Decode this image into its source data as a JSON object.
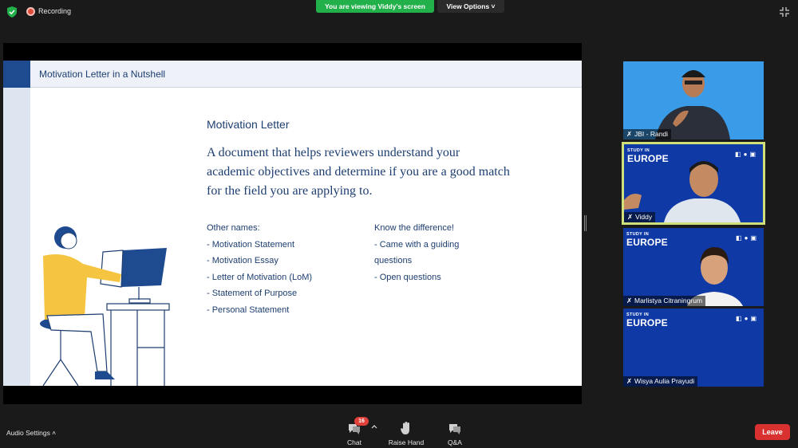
{
  "top_bar": {
    "recording_label": "Recording",
    "viewing_banner": "You are viewing Viddy's screen",
    "view_options_label": "View Options ˅"
  },
  "slide": {
    "title": "Motivation Letter in a Nutshell",
    "heading": "Motivation Letter",
    "definition": "A document that helps reviewers understand your academic objectives and determine if you are a good match for the field you are applying to.",
    "other_names_header": "Other names:",
    "other_names": [
      "- Motivation Statement",
      "- Motivation Essay",
      "- Letter of Motivation (LoM)",
      "- Statement of Purpose",
      "- Personal Statement"
    ],
    "difference_header": "Know the difference!",
    "difference_items": [
      "- Came with a guiding",
      "questions",
      "- Open questions"
    ]
  },
  "participants": [
    {
      "name": "JBI - Randi"
    },
    {
      "name": "Viddy"
    },
    {
      "name": "Marlistya Citraningrum"
    },
    {
      "name": "Wisya Aulia Prayudi"
    }
  ],
  "study_europe_logo": {
    "line1": "STUDY IN",
    "line2": "EUROPE"
  },
  "bottom_bar": {
    "audio_settings_label": "Audio Settings ˄",
    "chat_label": "Chat",
    "chat_badge": "16",
    "raise_hand_label": "Raise Hand",
    "qa_label": "Q&A",
    "leave_label": "Leave"
  },
  "colors": {
    "viewing_banner": "#22b04a",
    "leave": "#d93030",
    "slide_accent": "#1e4b8f",
    "active_speaker_border": "#cfe07a"
  }
}
